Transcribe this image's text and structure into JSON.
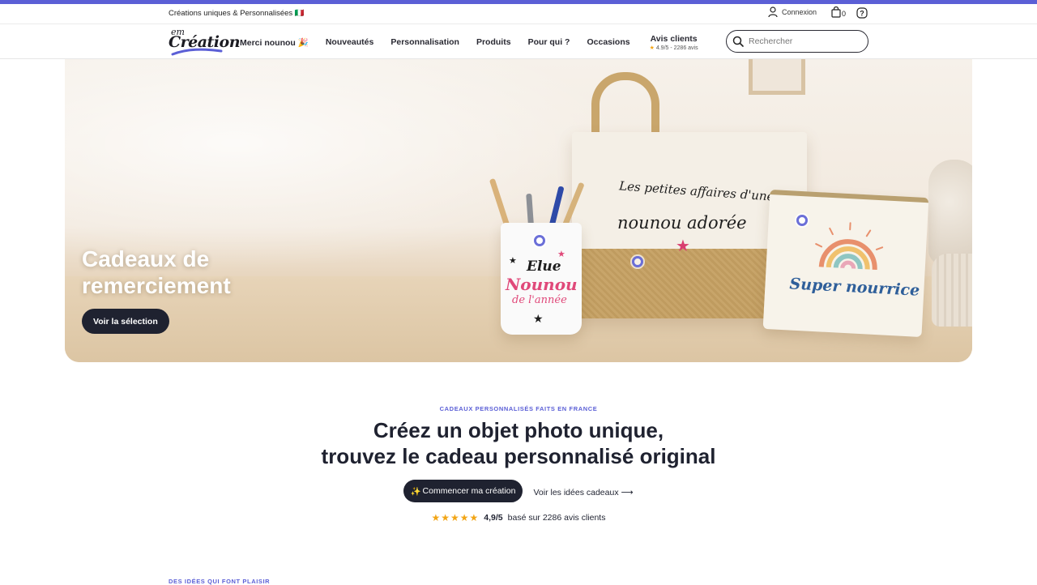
{
  "topbar": {
    "tagline": "Créations uniques & Personnalisées",
    "flag": "🇮🇹",
    "account_label": "Connexion",
    "cart_count": "0",
    "icons": [
      "user-icon",
      "shopping-bag-icon",
      "help-icon"
    ]
  },
  "header": {
    "logo_line1": "em",
    "logo_line2": "Création",
    "nav": [
      {
        "label": "Merci nounou 🎉"
      },
      {
        "label": "Nouveautés"
      },
      {
        "label": "Personnalisation"
      },
      {
        "label": "Produits"
      },
      {
        "label": "Pour qui ?"
      },
      {
        "label": "Occasions"
      }
    ],
    "reviews": {
      "title": "Avis clients",
      "star": "★",
      "summary": "4.9/5 - 2286 avis"
    },
    "search_placeholder": "Rechercher"
  },
  "hero": {
    "title": "Cadeaux de remerciement",
    "cta": "Voir la sélection",
    "tote_line1": "Les petites affaires d'une",
    "tote_line2": "nounou adorée",
    "tote_star": "★",
    "pouch_text": "Super nourrice",
    "mug_line1": "Elue",
    "mug_line2": "Nounou",
    "mug_line3": "de l'année",
    "mug_stars": [
      "★",
      "★",
      "★"
    ],
    "hotspot_count": 3
  },
  "intro": {
    "eyebrow": "CADEAUX PERSONNALISÉS FAITS EN FRANCE",
    "headline_line1": "Créez un objet photo unique,",
    "headline_line2": "trouvez le cadeau personnalisé original",
    "primary_icon": "✨",
    "primary_label": "Commencer ma création",
    "secondary_label": "Voir les idées cadeaux ⟶",
    "stars": "★★★★★",
    "score": "4,9/5",
    "rating_text": "basé sur 2286 avis clients"
  },
  "next_section": {
    "eyebrow": "DES IDÉES QUI FONT PLAISIR"
  },
  "colors": {
    "accent": "#5b5fd6",
    "dark": "#1f2230",
    "star": "#f2a516",
    "pink": "#e0497a"
  }
}
